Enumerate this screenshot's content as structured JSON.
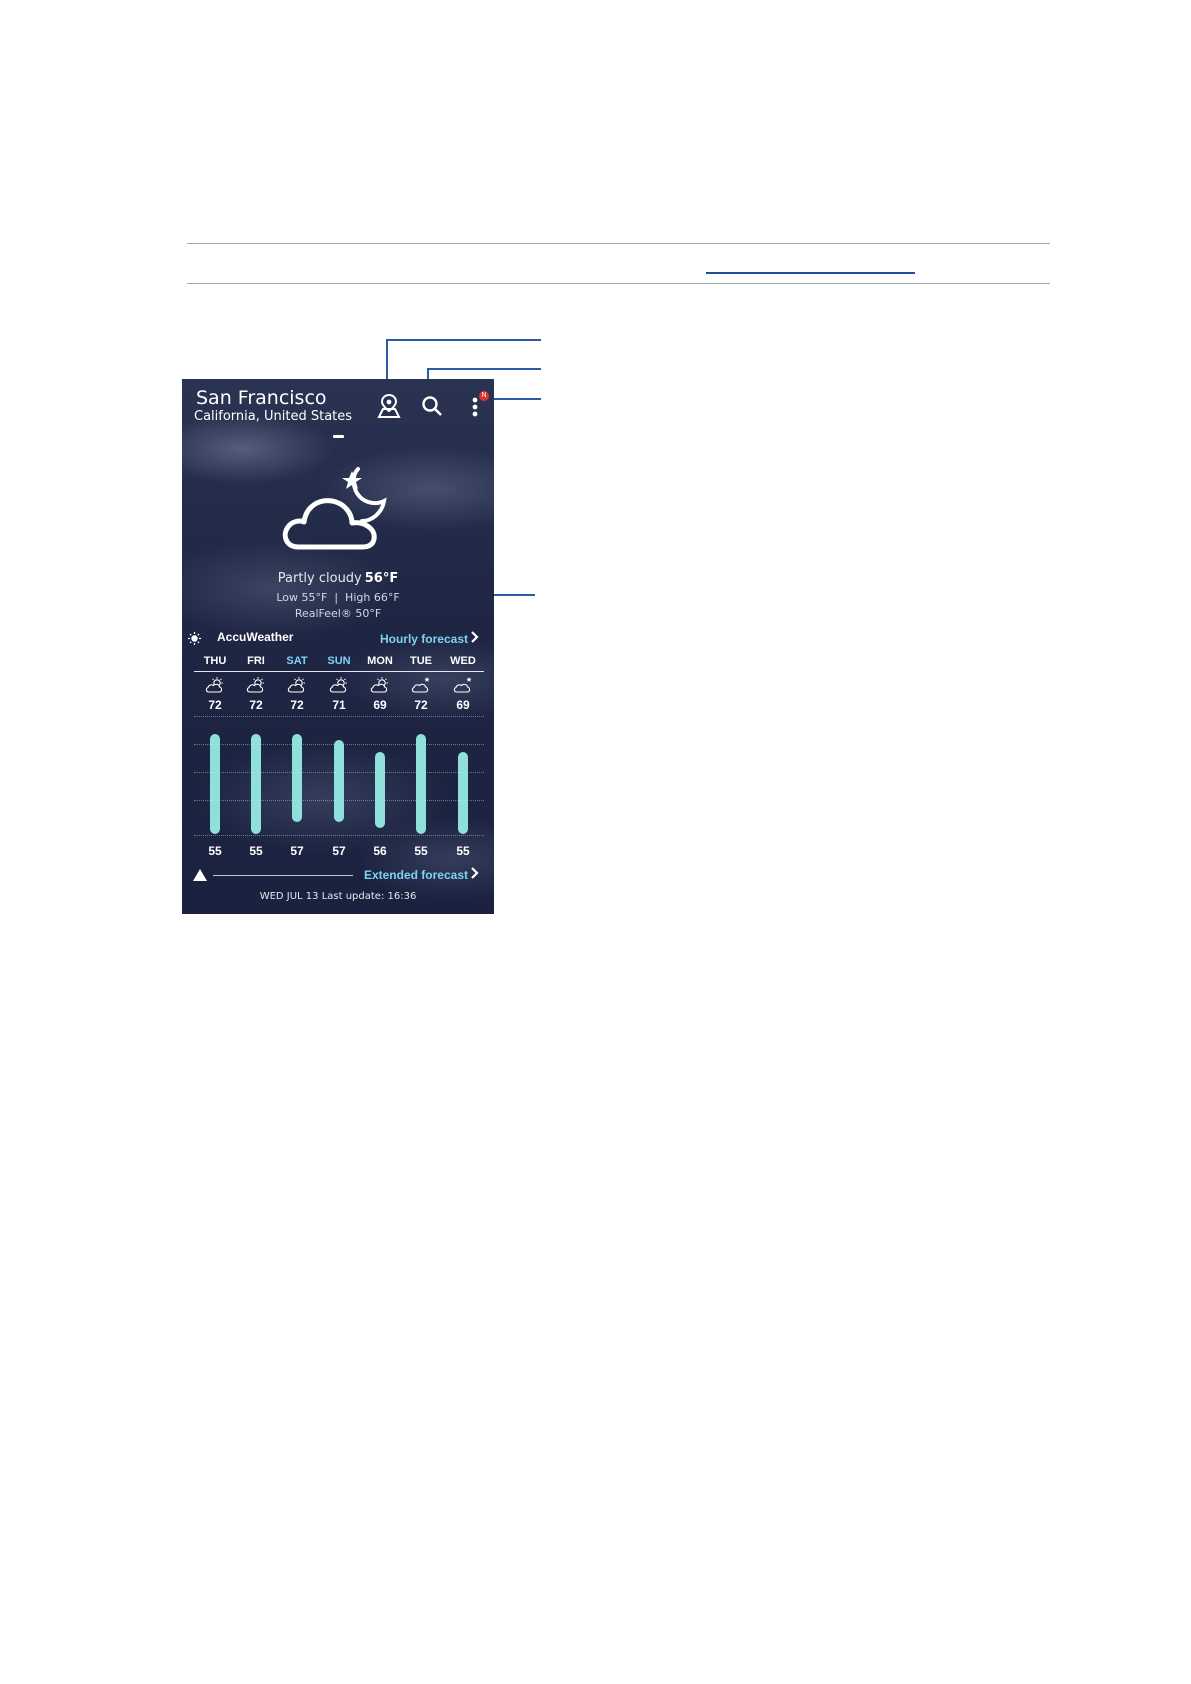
{
  "weather": {
    "city": "San Francisco",
    "region": "California, United States",
    "condition": "Partly cloudy",
    "current_temp": "56°F",
    "low": "Low 55°F",
    "separator": "|",
    "high": "High 66°F",
    "realfeel": "RealFeel® 50°F",
    "brand": "AccuWeather",
    "hourly_label": "Hourly forecast",
    "extended_label": "Extended forecast",
    "last_update": "WED JUL 13 Last update: 16:36",
    "badge": "N",
    "days": [
      {
        "label": "THU",
        "high": "72",
        "low": "55",
        "weekend": false
      },
      {
        "label": "FRI",
        "high": "72",
        "low": "55",
        "weekend": false
      },
      {
        "label": "SAT",
        "high": "72",
        "low": "57",
        "weekend": true
      },
      {
        "label": "SUN",
        "high": "71",
        "low": "57",
        "weekend": true
      },
      {
        "label": "MON",
        "high": "69",
        "low": "56",
        "weekend": false
      },
      {
        "label": "TUE",
        "high": "72",
        "low": "55",
        "weekend": false
      },
      {
        "label": "WED",
        "high": "69",
        "low": "55",
        "weekend": false
      }
    ]
  },
  "icons": {
    "current": "partly-cloudy-night-icon",
    "toolbar": [
      "location-pin-icon",
      "search-icon",
      "more-vert-icon"
    ],
    "forecast": [
      "partly-sunny-icon",
      "partly-sunny-icon",
      "partly-sunny-icon",
      "partly-sunny-icon",
      "partly-sunny-icon",
      "partly-cloudy-icon",
      "partly-cloudy-icon"
    ]
  },
  "colors": {
    "accent": "#7fd3f2",
    "bar": "#8fe0dc",
    "callout": "#2a5caa",
    "background": "#1e2644"
  }
}
